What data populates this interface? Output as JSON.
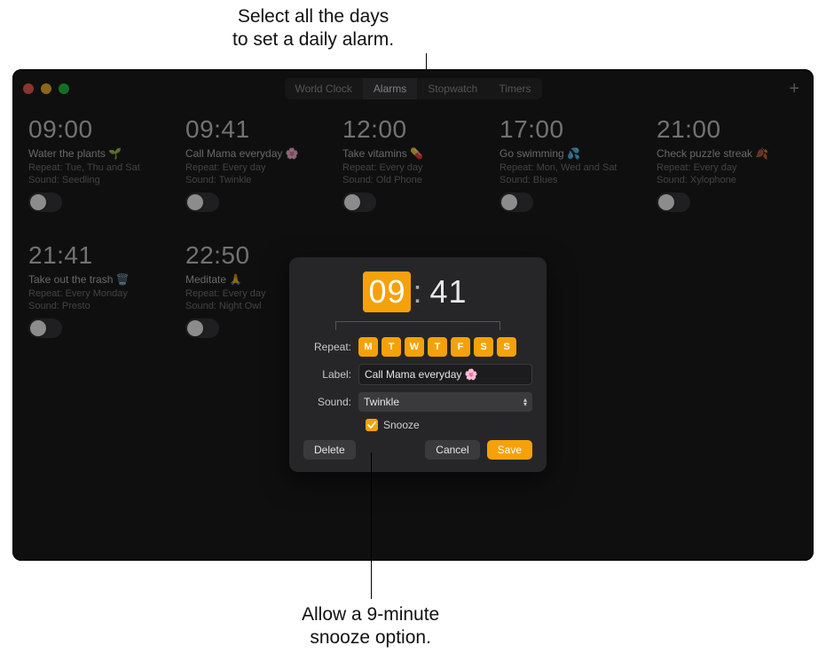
{
  "annotations": {
    "top": "Select all the days\nto set a daily alarm.",
    "bottom": "Allow a 9-minute\nsnooze option."
  },
  "tabs": {
    "items": [
      "World Clock",
      "Alarms",
      "Stopwatch",
      "Timers"
    ],
    "active": "Alarms"
  },
  "add_glyph": "+",
  "alarms": [
    {
      "time": "09:00",
      "label": "Water the plants 🌱",
      "repeat": "Repeat: Tue, Thu and Sat",
      "sound": "Sound: Seedling"
    },
    {
      "time": "09:41",
      "label": "Call Mama everyday 🌸",
      "repeat": "Repeat: Every day",
      "sound": "Sound: Twinkle"
    },
    {
      "time": "12:00",
      "label": "Take vitamins 💊",
      "repeat": "Repeat: Every day",
      "sound": "Sound: Old Phone"
    },
    {
      "time": "17:00",
      "label": "Go swimming 💦",
      "repeat": "Repeat: Mon, Wed and Sat",
      "sound": "Sound: Blues"
    },
    {
      "time": "21:00",
      "label": "Check puzzle streak 🍂",
      "repeat": "Repeat: Every day",
      "sound": "Sound: Xylophone"
    },
    {
      "time": "21:41",
      "label": "Take out the trash 🗑️",
      "repeat": "Repeat: Every Monday",
      "sound": "Sound: Presto"
    },
    {
      "time": "22:50",
      "label": "Meditate 🙏",
      "repeat": "Repeat: Every day",
      "sound": "Sound: Night Owl"
    }
  ],
  "modal": {
    "hour": "09",
    "minute": "41",
    "repeat_label": "Repeat:",
    "days": [
      "M",
      "T",
      "W",
      "T",
      "F",
      "S",
      "S"
    ],
    "label_label": "Label:",
    "label_value": "Call Mama everyday 🌸",
    "sound_label": "Sound:",
    "sound_value": "Twinkle",
    "snooze_label": "Snooze",
    "delete": "Delete",
    "cancel": "Cancel",
    "save": "Save"
  }
}
